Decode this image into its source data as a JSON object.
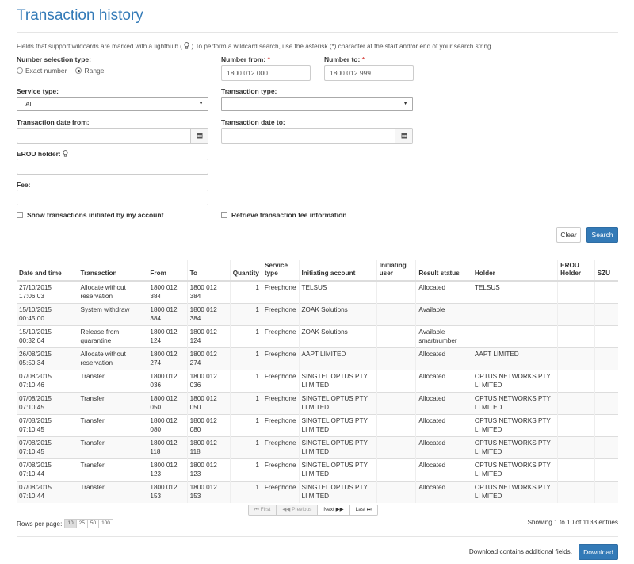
{
  "page": {
    "title": "Transaction history"
  },
  "hint": {
    "text_before": "Fields that support wildcards are marked with a lightbulb (",
    "text_after": ").To perform a wildcard search, use the asterisk (*) character at the start and/or end of your search string."
  },
  "form": {
    "number_selection": {
      "label": "Number selection type:",
      "options": [
        "Exact number",
        "Range"
      ],
      "selected": "Range"
    },
    "number_from": {
      "label": "Number from:",
      "required_mark": "*",
      "value": "1800 012 000"
    },
    "number_to": {
      "label": "Number to:",
      "required_mark": "*",
      "value": "1800 012 999"
    },
    "service_type": {
      "label": "Service type:",
      "value": "All"
    },
    "transaction_type": {
      "label": "Transaction type:",
      "value": ""
    },
    "date_from": {
      "label": "Transaction date from:",
      "value": ""
    },
    "date_to": {
      "label": "Transaction date to:",
      "value": ""
    },
    "erou_holder": {
      "label": "EROU holder:",
      "value": ""
    },
    "fee": {
      "label": "Fee:",
      "value": ""
    },
    "show_mine": {
      "label": "Show transactions initiated by my account",
      "checked": false
    },
    "retrieve_fee": {
      "label": "Retrieve transaction fee information",
      "checked": false
    },
    "clear_label": "Clear",
    "search_label": "Search"
  },
  "table": {
    "columns": [
      "Date and time",
      "Transaction",
      "From",
      "To",
      "Quantity",
      "Service type",
      "Initiating account",
      "Initiating user",
      "Result status",
      "Holder",
      "EROU Holder",
      "SZU"
    ],
    "rows": [
      [
        "27/10/2015 17:06:03",
        "Allocate without reservation",
        "1800 012 384",
        "1800 012 384",
        "1",
        "Freephone",
        "TELSUS",
        "",
        "Allocated",
        "TELSUS",
        "",
        ""
      ],
      [
        "15/10/2015 00:45:00",
        "System withdraw",
        "1800 012 384",
        "1800 012 384",
        "1",
        "Freephone",
        "ZOAK Solutions",
        "",
        "Available",
        "",
        "",
        ""
      ],
      [
        "15/10/2015 00:32:04",
        "Release from quarantine",
        "1800 012 124",
        "1800 012 124",
        "1",
        "Freephone",
        "ZOAK Solutions",
        "",
        "Available smartnumber",
        "",
        "",
        ""
      ],
      [
        "26/08/2015 05:50:34",
        "Allocate without reservation",
        "1800 012 274",
        "1800 012 274",
        "1",
        "Freephone",
        "AAPT LIMITED",
        "",
        "Allocated",
        "AAPT LIMITED",
        "",
        ""
      ],
      [
        "07/08/2015 07:10:46",
        "Transfer",
        "1800 012 036",
        "1800 012 036",
        "1",
        "Freephone",
        "SINGTEL OPTUS PTY LI MITED",
        "",
        "Allocated",
        "OPTUS NETWORKS PTY LI MITED",
        "",
        ""
      ],
      [
        "07/08/2015 07:10:45",
        "Transfer",
        "1800 012 050",
        "1800 012 050",
        "1",
        "Freephone",
        "SINGTEL OPTUS PTY LI MITED",
        "",
        "Allocated",
        "OPTUS NETWORKS PTY LI MITED",
        "",
        ""
      ],
      [
        "07/08/2015 07:10:45",
        "Transfer",
        "1800 012 080",
        "1800 012 080",
        "1",
        "Freephone",
        "SINGTEL OPTUS PTY LI MITED",
        "",
        "Allocated",
        "OPTUS NETWORKS PTY LI MITED",
        "",
        ""
      ],
      [
        "07/08/2015 07:10:45",
        "Transfer",
        "1800 012 118",
        "1800 012 118",
        "1",
        "Freephone",
        "SINGTEL OPTUS PTY LI MITED",
        "",
        "Allocated",
        "OPTUS NETWORKS PTY LI MITED",
        "",
        ""
      ],
      [
        "07/08/2015 07:10:44",
        "Transfer",
        "1800 012 123",
        "1800 012 123",
        "1",
        "Freephone",
        "SINGTEL OPTUS PTY LI MITED",
        "",
        "Allocated",
        "OPTUS NETWORKS PTY LI MITED",
        "",
        ""
      ],
      [
        "07/08/2015 07:10:44",
        "Transfer",
        "1800 012 153",
        "1800 012 153",
        "1",
        "Freephone",
        "SINGTEL OPTUS PTY LI MITED",
        "",
        "Allocated",
        "OPTUS NETWORKS PTY LI MITED",
        "",
        ""
      ]
    ]
  },
  "pagination": {
    "first": "First",
    "previous": "Previous",
    "next": "Next",
    "last": "Last",
    "rows_per_page_label": "Rows per page:",
    "rows_per_page_options": [
      "10",
      "25",
      "50",
      "100"
    ],
    "rows_per_page_selected": "10",
    "showing": "Showing 1 to 10 of 1133 entries"
  },
  "download": {
    "note": "Download contains additional fields.",
    "label": "Download"
  },
  "colors": {
    "accent": "#337ab7",
    "required": "#d9534f"
  },
  "icons": [
    "lightbulb-icon",
    "calendar-icon",
    "chevron-down-icon",
    "first-page-icon",
    "previous-page-icon",
    "next-page-icon",
    "last-page-icon"
  ]
}
